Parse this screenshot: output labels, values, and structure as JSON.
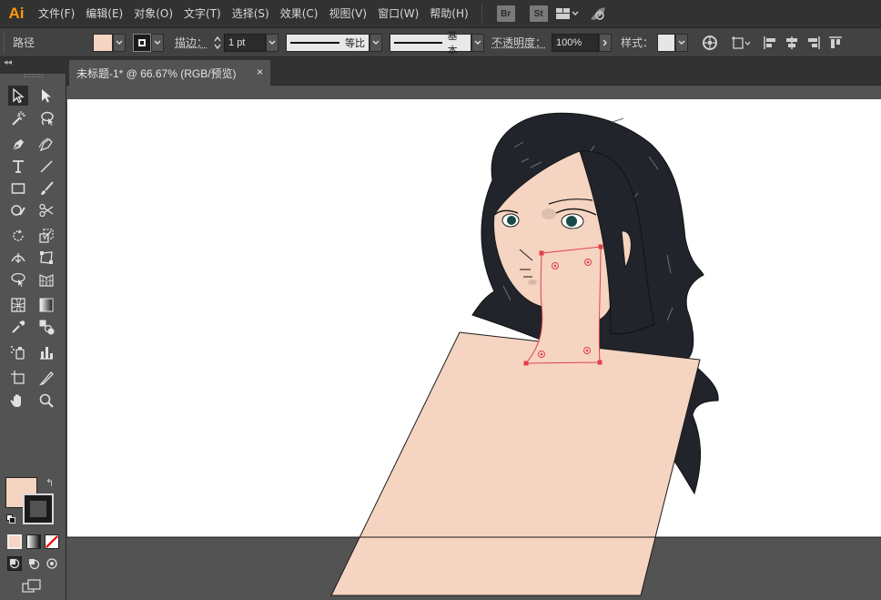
{
  "app": {
    "logo": "Ai"
  },
  "menu": {
    "items": [
      "文件(F)",
      "编辑(E)",
      "对象(O)",
      "文字(T)",
      "选择(S)",
      "效果(C)",
      "视图(V)",
      "窗口(W)",
      "帮助(H)"
    ],
    "bridge_badge": "Br",
    "stock_badge": "St"
  },
  "control": {
    "selection_label": "路径",
    "stroke_label": "描边：",
    "stroke_weight": "1 pt",
    "profile_label": "等比",
    "brush_label": "基本",
    "opacity_label": "不透明度：",
    "opacity_value": "100%",
    "style_label": "样式："
  },
  "document": {
    "tab_title": "未标题-1* @ 66.67% (RGB/预览)",
    "close_glyph": "×"
  },
  "toolbar": {
    "collapse_glyph": "◂◂",
    "swap_glyph": "↰"
  },
  "colors": {
    "fill": "#f5d4c1",
    "stroke": "#1a1a1a",
    "selection": "#e0414b",
    "hair": "#22242b",
    "app_accent": "#ff9a00"
  }
}
